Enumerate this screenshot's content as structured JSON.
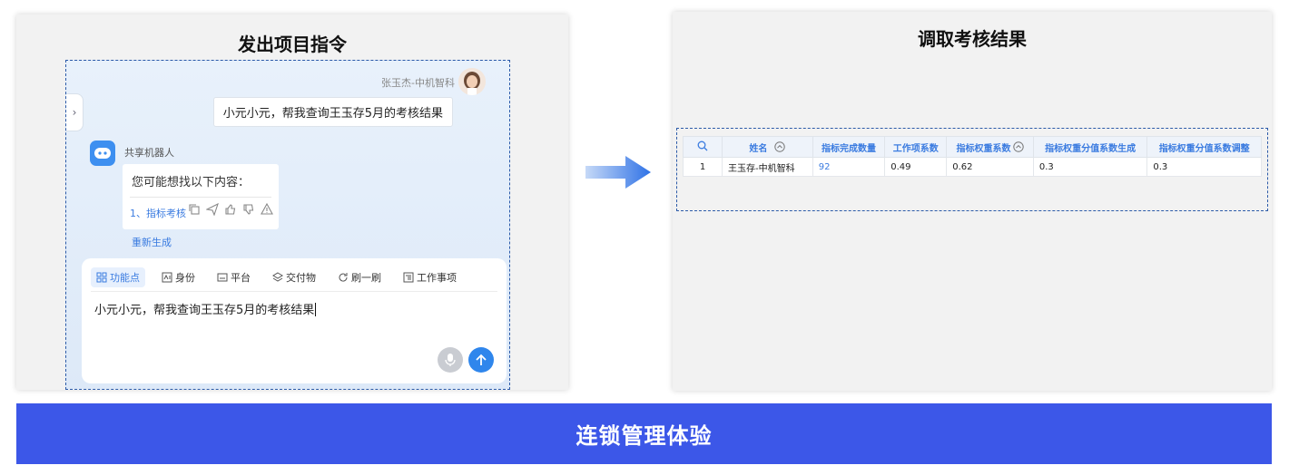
{
  "left_panel": {
    "title": "发出项目指令",
    "user": {
      "name": "张玉杰-中机智科",
      "message": "小元小元，帮我查询王玉存5月的考核结果"
    },
    "bot": {
      "name": "共享机器人",
      "hint": "您可能想找以下内容：",
      "option": "1、指标考核",
      "action_icons": [
        "copy-icon",
        "send-icon",
        "thumbs-up-icon",
        "thumbs-down-icon",
        "warning-icon"
      ],
      "regenerate": "重新生成"
    },
    "toolbar": {
      "items": [
        {
          "label": "功能点",
          "icon": "grid-icon",
          "active": true
        },
        {
          "label": "身份",
          "icon": "id-card-icon"
        },
        {
          "label": "平台",
          "icon": "platform-icon"
        },
        {
          "label": "交付物",
          "icon": "layers-icon"
        },
        {
          "label": "刷一刷",
          "icon": "refresh-icon"
        },
        {
          "label": "工作事项",
          "icon": "task-icon"
        }
      ]
    },
    "input_value": "小元小元，帮我查询王玉存5月的考核结果"
  },
  "right_panel": {
    "title": "调取考核结果",
    "table": {
      "headers": [
        "",
        "姓名",
        "指标完成数量",
        "工作项系数",
        "指标权重系数",
        "指标权重分值系数生成",
        "指标权重分值系数调整"
      ],
      "rows": [
        [
          "1",
          "王玉存-中机智科",
          "92",
          "0.49",
          "0.62",
          "0.3",
          "0.3"
        ]
      ]
    }
  },
  "banner": {
    "text": "连锁管理体验"
  },
  "colors": {
    "accent": "#3a7be0",
    "banner": "#3c57e8",
    "frame_dash": "#2b5aa8"
  }
}
